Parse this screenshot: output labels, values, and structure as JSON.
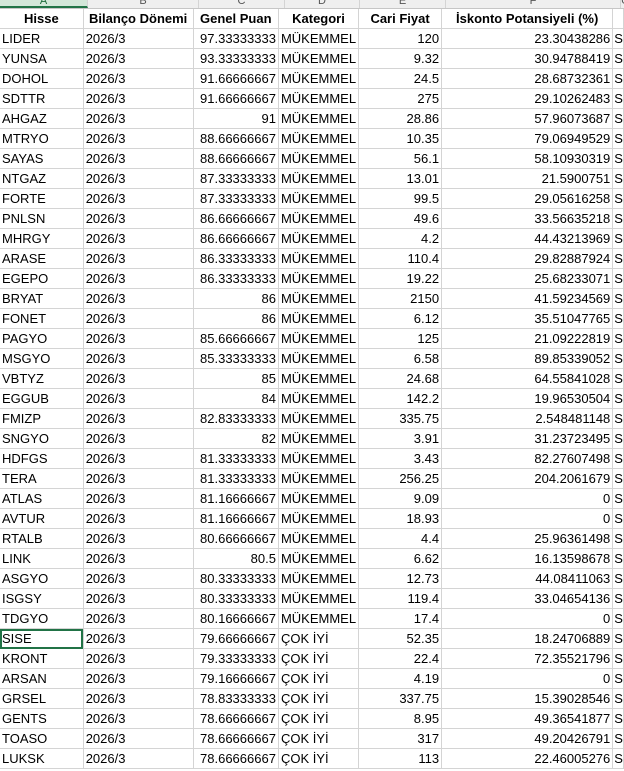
{
  "column_letters": [
    "A",
    "B",
    "C",
    "D",
    "E",
    "F",
    "G"
  ],
  "selected_column": "A",
  "headers": [
    "Hisse",
    "Bilanço Dönemi",
    "Genel Puan",
    "Kategori",
    "Cari Fiyat",
    "İskonto Potansiyeli (%)",
    ""
  ],
  "active_cell": "A32",
  "rows": [
    [
      "LIDER",
      "2026/3",
      "97.33333333",
      "MÜKEMMEL",
      "120",
      "23.30438286",
      "S"
    ],
    [
      "YUNSA",
      "2026/3",
      "93.33333333",
      "MÜKEMMEL",
      "9.32",
      "30.94788419",
      "S"
    ],
    [
      "DOHOL",
      "2026/3",
      "91.66666667",
      "MÜKEMMEL",
      "24.5",
      "28.68732361",
      "S"
    ],
    [
      "SDTTR",
      "2026/3",
      "91.66666667",
      "MÜKEMMEL",
      "275",
      "29.10262483",
      "S"
    ],
    [
      "AHGAZ",
      "2026/3",
      "91",
      "MÜKEMMEL",
      "28.86",
      "57.96073687",
      "S"
    ],
    [
      "MTRYO",
      "2026/3",
      "88.66666667",
      "MÜKEMMEL",
      "10.35",
      "79.06949529",
      "S"
    ],
    [
      "SAYAS",
      "2026/3",
      "88.66666667",
      "MÜKEMMEL",
      "56.1",
      "58.10930319",
      "S"
    ],
    [
      "NTGAZ",
      "2026/3",
      "87.33333333",
      "MÜKEMMEL",
      "13.01",
      "21.5900751",
      "S"
    ],
    [
      "FORTE",
      "2026/3",
      "87.33333333",
      "MÜKEMMEL",
      "99.5",
      "29.05616258",
      "S"
    ],
    [
      "PNLSN",
      "2026/3",
      "86.66666667",
      "MÜKEMMEL",
      "49.6",
      "33.56635218",
      "S"
    ],
    [
      "MHRGY",
      "2026/3",
      "86.66666667",
      "MÜKEMMEL",
      "4.2",
      "44.43213969",
      "S"
    ],
    [
      "ARASE",
      "2026/3",
      "86.33333333",
      "MÜKEMMEL",
      "110.4",
      "29.82887924",
      "S"
    ],
    [
      "EGEPO",
      "2026/3",
      "86.33333333",
      "MÜKEMMEL",
      "19.22",
      "25.68233071",
      "S"
    ],
    [
      "BRYAT",
      "2026/3",
      "86",
      "MÜKEMMEL",
      "2150",
      "41.59234569",
      "S"
    ],
    [
      "FONET",
      "2026/3",
      "86",
      "MÜKEMMEL",
      "6.12",
      "35.51047765",
      "S"
    ],
    [
      "PAGYO",
      "2026/3",
      "85.66666667",
      "MÜKEMMEL",
      "125",
      "21.09222819",
      "S"
    ],
    [
      "MSGYO",
      "2026/3",
      "85.33333333",
      "MÜKEMMEL",
      "6.58",
      "89.85339052",
      "S"
    ],
    [
      "VBTYZ",
      "2026/3",
      "85",
      "MÜKEMMEL",
      "24.68",
      "64.55841028",
      "S"
    ],
    [
      "EGGUB",
      "2026/3",
      "84",
      "MÜKEMMEL",
      "142.2",
      "19.96530504",
      "S"
    ],
    [
      "FMIZP",
      "2026/3",
      "82.83333333",
      "MÜKEMMEL",
      "335.75",
      "2.548481148",
      "S"
    ],
    [
      "SNGYO",
      "2026/3",
      "82",
      "MÜKEMMEL",
      "3.91",
      "31.23723495",
      "S"
    ],
    [
      "HDFGS",
      "2026/3",
      "81.33333333",
      "MÜKEMMEL",
      "3.43",
      "82.27607498",
      "S"
    ],
    [
      "TERA",
      "2026/3",
      "81.33333333",
      "MÜKEMMEL",
      "256.25",
      "204.2061679",
      "S"
    ],
    [
      "ATLAS",
      "2026/3",
      "81.16666667",
      "MÜKEMMEL",
      "9.09",
      "0",
      "S"
    ],
    [
      "AVTUR",
      "2026/3",
      "81.16666667",
      "MÜKEMMEL",
      "18.93",
      "0",
      "S"
    ],
    [
      "RTALB",
      "2026/3",
      "80.66666667",
      "MÜKEMMEL",
      "4.4",
      "25.96361498",
      "S"
    ],
    [
      "LINK",
      "2026/3",
      "80.5",
      "MÜKEMMEL",
      "6.62",
      "16.13598678",
      "S"
    ],
    [
      "ASGYO",
      "2026/3",
      "80.33333333",
      "MÜKEMMEL",
      "12.73",
      "44.08411063",
      "S"
    ],
    [
      "ISGSY",
      "2026/3",
      "80.33333333",
      "MÜKEMMEL",
      "119.4",
      "33.04654136",
      "S"
    ],
    [
      "TDGYO",
      "2026/3",
      "80.16666667",
      "MÜKEMMEL",
      "17.4",
      "0",
      "S"
    ],
    [
      "SISE",
      "2026/3",
      "79.66666667",
      "ÇOK İYİ",
      "52.35",
      "18.24706889",
      "S"
    ],
    [
      "KRONT",
      "2026/3",
      "79.33333333",
      "ÇOK İYİ",
      "22.4",
      "72.35521796",
      "S"
    ],
    [
      "ARSAN",
      "2026/3",
      "79.16666667",
      "ÇOK İYİ",
      "4.19",
      "0",
      "S"
    ],
    [
      "GRSEL",
      "2026/3",
      "78.83333333",
      "ÇOK İYİ",
      "337.75",
      "15.39028546",
      "S"
    ],
    [
      "GENTS",
      "2026/3",
      "78.66666667",
      "ÇOK İYİ",
      "8.95",
      "49.36541877",
      "S"
    ],
    [
      "TOASO",
      "2026/3",
      "78.66666667",
      "ÇOK İYİ",
      "317",
      "49.20426791",
      "S"
    ],
    [
      "LUKSK",
      "2026/3",
      "78.66666667",
      "ÇOK İYİ",
      "113",
      "22.46005276",
      "S"
    ]
  ]
}
